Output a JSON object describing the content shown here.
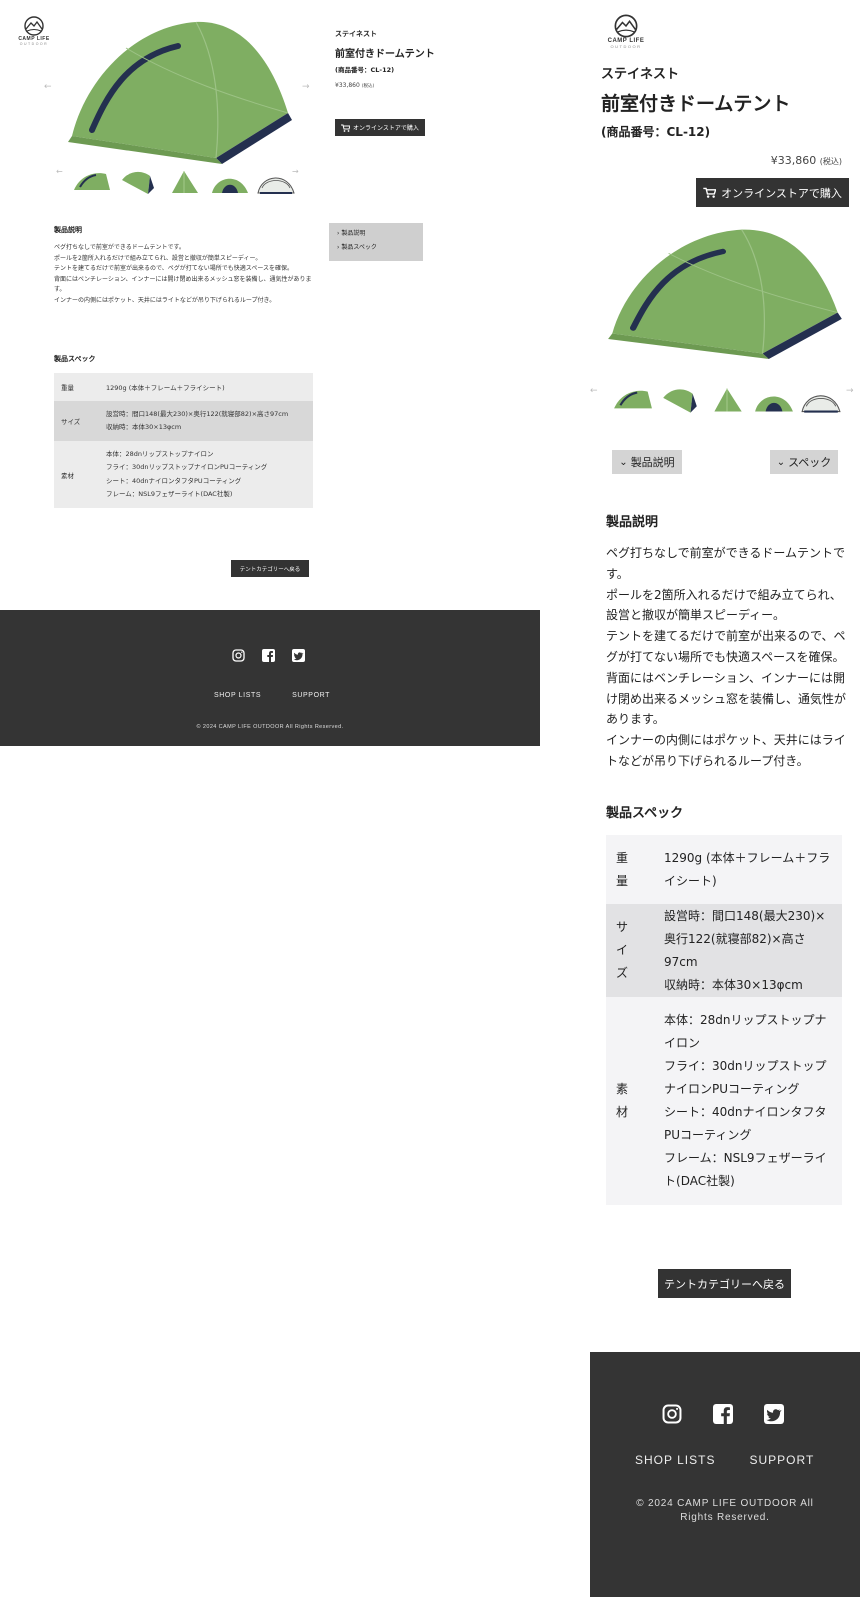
{
  "brand": {
    "name": "CAMP LIFE",
    "sub": "OUTDOOR"
  },
  "product": {
    "maker": "ステイネスト",
    "name": "前室付きドームテント",
    "code": "(商品番号：CL-12)",
    "price": "¥33,860",
    "tax": "(税込)",
    "buy_label": "オンラインストアで購入"
  },
  "gallery": {
    "thumb_count": 5,
    "prev_label": "←",
    "next_label": "→"
  },
  "anchor_nav": {
    "desktop": [
      "製品説明",
      "製品スペック"
    ],
    "mobile": [
      "製品説明",
      "スペック"
    ]
  },
  "description": {
    "heading": "製品説明",
    "lines": [
      "ペグ打ちなしで前室ができるドームテントです。",
      "ポールを2箇所入れるだけで組み立てられ、設営と撤収が簡単スピーディー。",
      "テントを建てるだけで前室が出来るので、ペグが打てない場所でも快適スペースを確保。",
      "背面にはベンチレーション、インナーには開け閉め出来るメッシュ窓を装備し、通気性があります。",
      "インナーの内側にはポケット、天井にはライトなどが吊り下げられるループ付き。"
    ]
  },
  "spec": {
    "heading": "製品スペック",
    "rows": [
      {
        "label": "重量",
        "values": [
          "1290g (本体＋フレーム＋フライシート)"
        ]
      },
      {
        "label": "サイズ",
        "values": [
          "設営時：間口148(最大230)×奥行122(就寝部82)×高さ97cm",
          "収納時：本体30×13φcm"
        ]
      },
      {
        "label": "素材",
        "values": [
          "本体：28dnリップストップナイロン",
          "フライ：30dnリップストップナイロンPUコーティング",
          "シート：40dnナイロンタフタPUコーティング",
          "フレーム：NSL9フェザーライト(DAC社製)"
        ]
      }
    ]
  },
  "back_button": "テントカテゴリーへ戻る",
  "footer": {
    "links": [
      "SHOP LISTS",
      "SUPPORT"
    ],
    "copyright": "© 2024 CAMP LIFE OUTDOOR All Rights Reserved."
  },
  "colors": {
    "tent_green": "#7fae62",
    "tent_light": "#a3c98a",
    "tent_navy": "#24304f",
    "footer_bg": "#343434",
    "button_dark": "#333333"
  }
}
